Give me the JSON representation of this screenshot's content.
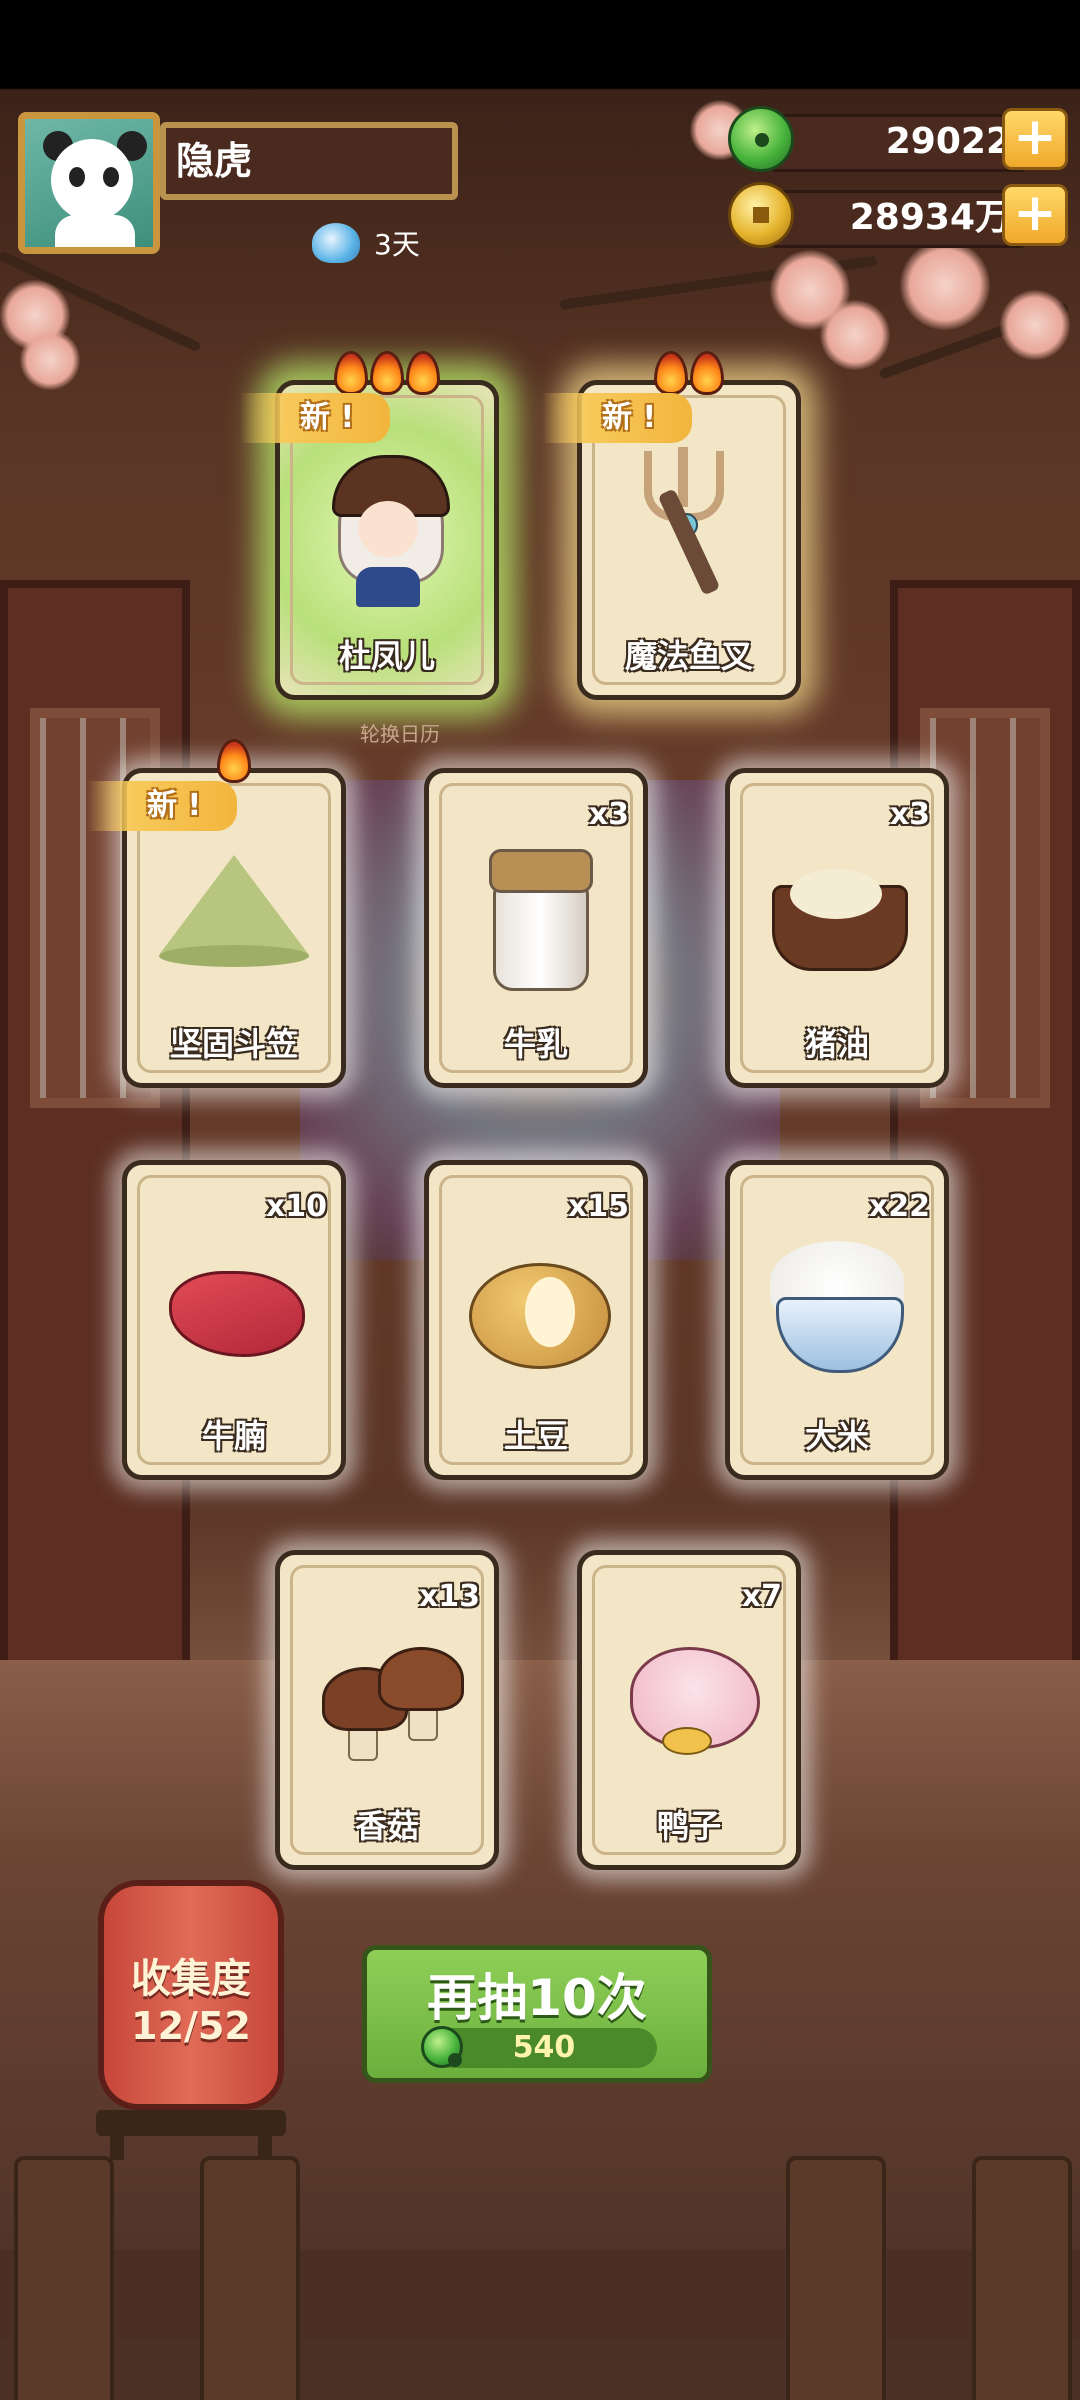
{
  "player": {
    "name": "隐虎",
    "days": "3天"
  },
  "currency": {
    "jade": {
      "value": "29022",
      "add_label": "+"
    },
    "coins": {
      "value": "28934万",
      "add_label": "+"
    }
  },
  "rotate_label": "轮换日历",
  "cards": [
    {
      "name": "杜凤儿",
      "qty": "",
      "is_new": true,
      "flames": 3,
      "art": "girl-character-icon"
    },
    {
      "name": "魔法鱼叉",
      "qty": "",
      "is_new": true,
      "flames": 2,
      "art": "trident-icon"
    },
    {
      "name": "坚固斗笠",
      "qty": "",
      "is_new": true,
      "flames": 1,
      "art": "straw-hat-icon"
    },
    {
      "name": "牛乳",
      "qty": "x3",
      "is_new": false,
      "flames": 0,
      "art": "milk-jar-icon"
    },
    {
      "name": "猪油",
      "qty": "x3",
      "is_new": false,
      "flames": 0,
      "art": "lard-pot-icon"
    },
    {
      "name": "牛腩",
      "qty": "x10",
      "is_new": false,
      "flames": 0,
      "art": "beef-icon"
    },
    {
      "name": "土豆",
      "qty": "x15",
      "is_new": false,
      "flames": 0,
      "art": "potato-icon"
    },
    {
      "name": "大米",
      "qty": "x22",
      "is_new": false,
      "flames": 0,
      "art": "rice-bowl-icon"
    },
    {
      "name": "香菇",
      "qty": "x13",
      "is_new": false,
      "flames": 0,
      "art": "mushroom-icon"
    },
    {
      "name": "鸭子",
      "qty": "x7",
      "is_new": false,
      "flames": 0,
      "art": "duck-icon"
    }
  ],
  "new_badge_label": "新",
  "collection": {
    "title": "收集度",
    "count": "12/52"
  },
  "draw_button": {
    "label": "再抽10次",
    "cost": "540"
  }
}
